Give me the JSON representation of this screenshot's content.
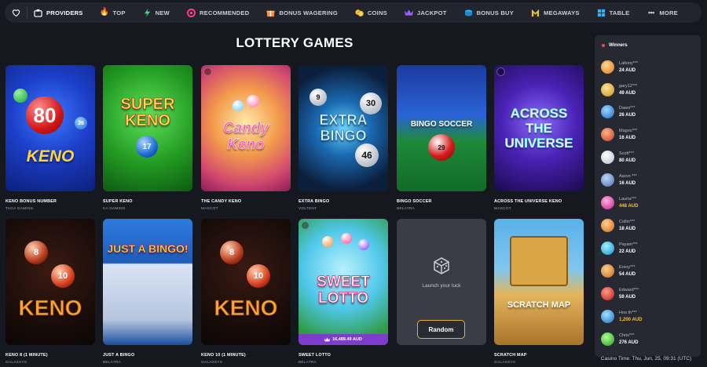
{
  "nav": {
    "items": [
      {
        "label": "PROVIDERS",
        "icon": "providers-icon",
        "color": "#ffffff"
      },
      {
        "label": "TOP",
        "icon": "flame-icon",
        "color": "#ff7a2e"
      },
      {
        "label": "NEW",
        "icon": "lightning-icon",
        "color": "#3ddc84"
      },
      {
        "label": "RECOMMENDED",
        "icon": "target-icon",
        "color": "#ff3f8e"
      },
      {
        "label": "BONUS WAGERING",
        "icon": "bonus-icon",
        "color": "#ff8a3d"
      },
      {
        "label": "COINS",
        "icon": "coins-icon",
        "color": "#f2c230"
      },
      {
        "label": "JACKPOT",
        "icon": "crown-icon",
        "color": "#a15cff"
      },
      {
        "label": "BONUS BUY",
        "icon": "bonus-buy-icon",
        "color": "#2fb5ff"
      },
      {
        "label": "MEGAWAYS",
        "icon": "megaways-icon",
        "color": "#f2c230"
      },
      {
        "label": "TABLE",
        "icon": "table-icon",
        "color": "#2fb5ff"
      },
      {
        "label": "MORE",
        "icon": "more-icon",
        "color": "#c9ccd6"
      }
    ]
  },
  "page": {
    "title": "LOTTERY GAMES"
  },
  "games": [
    {
      "name": "KENO BONUS NUMBER",
      "provider": "TAGA GAMING",
      "art": "KENO"
    },
    {
      "name": "SUPER KENO",
      "provider": "KA GAMING",
      "art": "SUPER KENO"
    },
    {
      "name": "THE CANDY KENO",
      "provider": "MASCOT",
      "art": "Candy Keno"
    },
    {
      "name": "EXTRA BINGO",
      "provider": "VOLTENT",
      "art": "EXTRA BINGO"
    },
    {
      "name": "BINGO SOCCER",
      "provider": "BELATRA",
      "art": "BINGO SOCCER"
    },
    {
      "name": "ACROSS THE UNIVERSE KENO",
      "provider": "MASCOT",
      "art": "ACROSS THE UNIVERSE"
    },
    {
      "name": "KENO 8 (1 MINUTE)",
      "provider": "GALAXSYS",
      "art": "KENO"
    },
    {
      "name": "JUST A BINGO",
      "provider": "BELATRA",
      "art": "JUST A BINGO!"
    },
    {
      "name": "KENO 10 (1 MINUTE)",
      "provider": "GALAXSYS",
      "art": "KENO"
    },
    {
      "name": "SWEET LOTTO",
      "provider": "BELATRA",
      "art": "SWEET LOTTO",
      "jackpot": "16,489.49 AUD"
    },
    {
      "name": "SCRATCH MAP",
      "provider": "GALAXSYS",
      "art": "SCRATCH MAP"
    }
  ],
  "random": {
    "text": "Launch your luck",
    "button": "Random"
  },
  "winners": {
    "title": "Winners",
    "list": [
      {
        "name": "Laltony***",
        "amount": "24 AUD",
        "highlight": false
      },
      {
        "name": "gary12***",
        "amount": "49 AUD",
        "highlight": false
      },
      {
        "name": "Dawo***",
        "amount": "26 AUD",
        "highlight": false
      },
      {
        "name": "Magoo***",
        "amount": "16 AUD",
        "highlight": false
      },
      {
        "name": "Scott***",
        "amount": "80 AUD",
        "highlight": false
      },
      {
        "name": "Aaron ***",
        "amount": "16 AUD",
        "highlight": false
      },
      {
        "name": "Laurta***",
        "amount": "448 AUD",
        "highlight": true
      },
      {
        "name": "Collin***",
        "amount": "18 AUD",
        "highlight": false
      },
      {
        "name": "Payam***",
        "amount": "22 AUD",
        "highlight": false
      },
      {
        "name": "Ersoy***",
        "amount": "54 AUD",
        "highlight": false
      },
      {
        "name": "Edward***",
        "amount": "59 AUD",
        "highlight": false
      },
      {
        "name": "Hoa th***",
        "amount": "1,200 AUD",
        "highlight": true
      },
      {
        "name": "Chris***",
        "amount": "276 AUD",
        "highlight": false
      }
    ]
  },
  "footer": {
    "casino_time": "Casino Time: Thu, Jun, 25, 09:31 (UTC)"
  }
}
